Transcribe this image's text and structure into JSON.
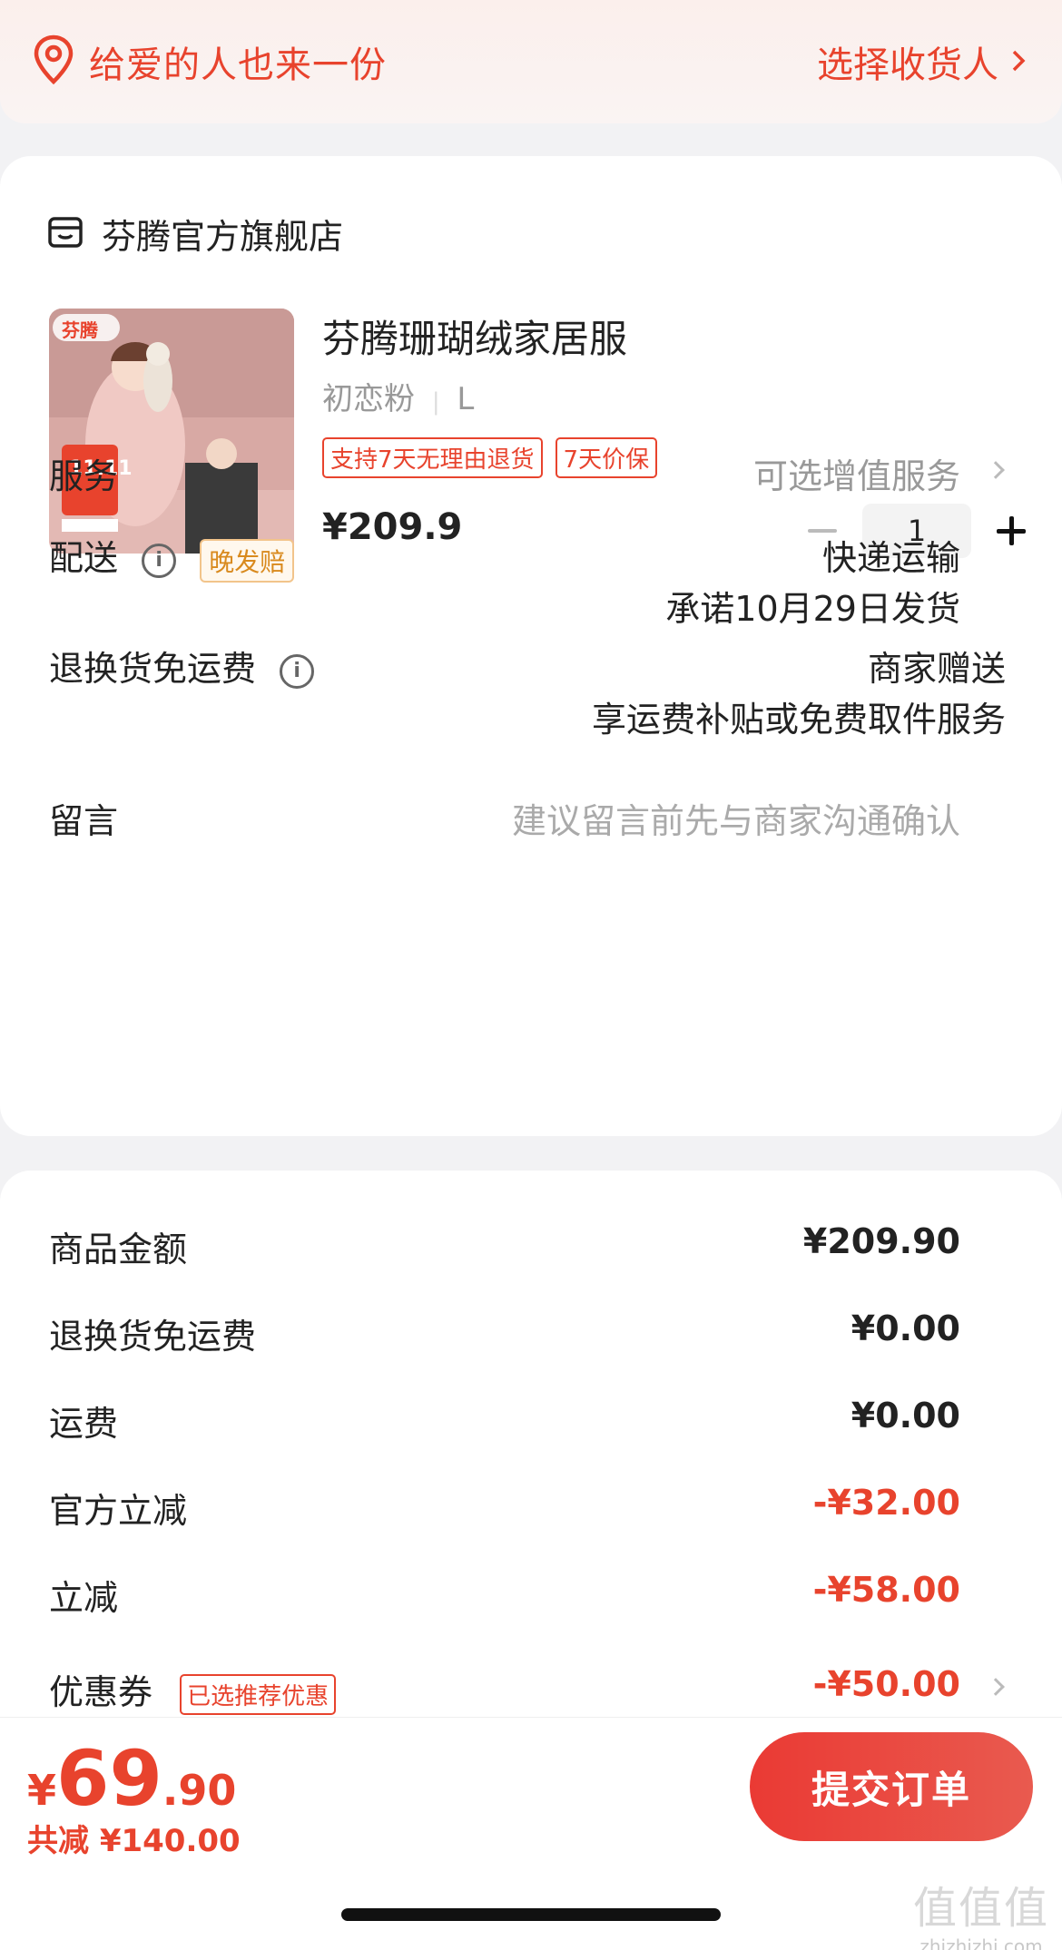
{
  "address_bar": {
    "gift_text": "给爱的人也来一份",
    "select_text": "选择收货人"
  },
  "shop": {
    "name": "芬腾官方旗舰店"
  },
  "product": {
    "title": "芬腾珊瑚绒家居服",
    "sku_color": "初恋粉",
    "sku_size": "L",
    "tags": [
      "支持7天无理由退货",
      "7天价保"
    ],
    "price": "¥209.9",
    "quantity": "1",
    "image_brand": "芬腾",
    "image_badge": "11.11"
  },
  "service": {
    "label": "服务",
    "value": "可选增值服务"
  },
  "delivery": {
    "label": "配送",
    "badge": "晚发赔",
    "method": "快递运输",
    "promise": "承诺10月29日发货"
  },
  "return_shipping": {
    "label": "退换货免运费",
    "value_line1": "商家赠送",
    "value_line2": "享运费补贴或免费取件服务"
  },
  "message": {
    "label": "留言",
    "placeholder": "建议留言前先与商家沟通确认"
  },
  "summary": {
    "goods_label": "商品金额",
    "goods_value": "¥209.90",
    "return_label": "退换货免运费",
    "return_value": "¥0.00",
    "freight_label": "运费",
    "freight_value": "¥0.00",
    "official_label": "官方立减",
    "official_value": "-¥32.00",
    "instant_label": "立减",
    "instant_value": "-¥58.00",
    "coupon_label": "优惠券",
    "coupon_badge": "已选推荐优惠",
    "coupon_value": "-¥50.00"
  },
  "bottom": {
    "currency": "¥",
    "total_int": "69",
    "total_dec": ".90",
    "saved": "共减 ¥140.00",
    "submit": "提交订单"
  },
  "watermark": {
    "logo": "值值值",
    "url": "zhizhizhi.com"
  },
  "colors": {
    "accent": "#e8432d",
    "badge_orange": "#d98a1e"
  }
}
